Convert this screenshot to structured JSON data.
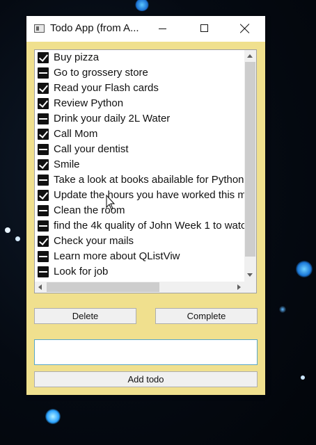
{
  "window": {
    "title": "Todo App (from A...",
    "controls": {
      "minimize_icon": "minimize-icon",
      "maximize_icon": "maximize-icon",
      "close_icon": "close-icon"
    },
    "background_color": "#f0e08e"
  },
  "todos": [
    {
      "label": "Buy pizza",
      "checked": true
    },
    {
      "label": "Go to grossery store",
      "checked": false
    },
    {
      "label": "Read your Flash cards",
      "checked": true
    },
    {
      "label": "Review Python",
      "checked": true
    },
    {
      "label": "Drink your daily 2L Water",
      "checked": false
    },
    {
      "label": "Call Mom",
      "checked": true
    },
    {
      "label": "Call your dentist",
      "checked": false
    },
    {
      "label": "Smile",
      "checked": true
    },
    {
      "label": "Take a look at books abailable for Python",
      "checked": false
    },
    {
      "label": "Update the hours you have worked this mo",
      "checked": true
    },
    {
      "label": "Clean the room",
      "checked": false
    },
    {
      "label": "find the 4k quality of John Week 1 to watc",
      "checked": false
    },
    {
      "label": "Check your mails",
      "checked": true
    },
    {
      "label": "Learn more about QListViw",
      "checked": false
    },
    {
      "label": "Look for job",
      "checked": false
    }
  ],
  "buttons": {
    "delete": "Delete",
    "complete": "Complete",
    "add": "Add todo"
  },
  "input": {
    "value": "",
    "placeholder": ""
  }
}
